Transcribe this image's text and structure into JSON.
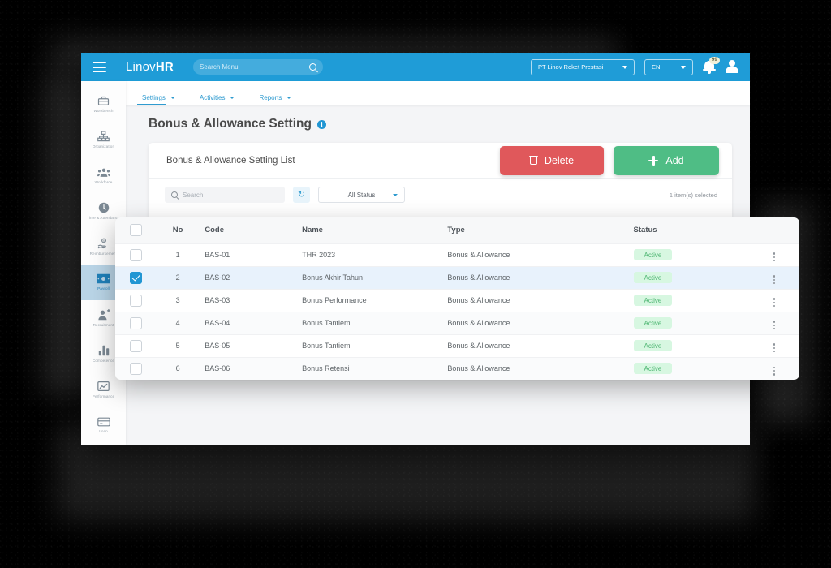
{
  "header": {
    "menu_icon": "hamburger-icon",
    "brand_light": "Linov",
    "brand_bold": "HR",
    "search_placeholder": "Search Menu",
    "search_value": "",
    "search_icon": "search-icon",
    "company": "PT Linov Roket Prestasi",
    "language": "EN",
    "notification_icon": "bell-icon",
    "notification_count": "99",
    "profile_icon": "user-avatar-icon",
    "bg_color": "#1f9cd7"
  },
  "sidebar": {
    "items": [
      {
        "label": "Workbench",
        "icon": "toolbox-icon",
        "glyph": "⚒",
        "active": false
      },
      {
        "label": "Organization",
        "icon": "org-chart-icon",
        "glyph": "☷",
        "active": false
      },
      {
        "label": "Workforce",
        "icon": "people-icon",
        "glyph": "὆5",
        "active": false
      },
      {
        "label": "Time & Attendance",
        "icon": "clock-icon",
        "glyph": "⏱",
        "active": false
      },
      {
        "label": "Reimbursement",
        "icon": "hand-money-icon",
        "glyph": "Ὃ0",
        "active": false
      },
      {
        "label": "Payroll",
        "icon": "banknote-icon",
        "glyph": "Ὃ5",
        "active": true
      },
      {
        "label": "Recruitment",
        "icon": "user-plus-icon",
        "glyph": "὆4",
        "active": false
      },
      {
        "label": "Competence",
        "icon": "bar-chart-icon",
        "glyph": "ὌA",
        "active": false
      },
      {
        "label": "Performance",
        "icon": "line-chart-icon",
        "glyph": "Ὄ8",
        "active": false
      },
      {
        "label": "Loan",
        "icon": "credit-card-icon",
        "glyph": "Ὃ3",
        "active": false
      }
    ]
  },
  "tabs": [
    {
      "label": "Settings",
      "active": true
    },
    {
      "label": "Activities",
      "active": false
    },
    {
      "label": "Reports",
      "active": false
    }
  ],
  "page": {
    "title": "Bonus & Allowance Setting",
    "info_icon": "info-icon",
    "info_glyph": "i"
  },
  "card": {
    "title": "Bonus & Allowance Setting List",
    "delete_label": "Delete",
    "delete_icon": "trash-icon",
    "delete_color": "#e0585b",
    "add_label": "Add",
    "add_icon": "plus-icon",
    "add_color": "#4fbd85",
    "search_placeholder": "Search",
    "search_value": "",
    "search_icon": "search-icon",
    "refresh_icon": "refresh-icon",
    "refresh_glyph": "↻",
    "status_filter": "All Status",
    "selected_text": "1 item(s) selected"
  },
  "table": {
    "columns": [
      "No",
      "Code",
      "Name",
      "Type",
      "Status"
    ],
    "header_checkbox_checked": false,
    "rows": [
      {
        "checked": false,
        "no": "1",
        "code": "BAS-01",
        "name": "THR 2023",
        "type": "Bonus & Allowance",
        "status": "Active"
      },
      {
        "checked": true,
        "no": "2",
        "code": "BAS-02",
        "name": "Bonus Akhir Tahun",
        "type": "Bonus & Allowance",
        "status": "Active"
      },
      {
        "checked": false,
        "no": "3",
        "code": "BAS-03",
        "name": "Bonus Performance",
        "type": "Bonus & Allowance",
        "status": "Active"
      },
      {
        "checked": false,
        "no": "4",
        "code": "BAS-04",
        "name": "Bonus Tantiem",
        "type": "Bonus & Allowance",
        "status": "Active"
      },
      {
        "checked": false,
        "no": "5",
        "code": "BAS-05",
        "name": "Bonus Tantiem",
        "type": "Bonus & Allowance",
        "status": "Active"
      },
      {
        "checked": false,
        "no": "6",
        "code": "BAS-06",
        "name": "Bonus Retensi",
        "type": "Bonus & Allowance",
        "status": "Active"
      }
    ],
    "row_menu_icon": "kebab-menu-icon",
    "status_badge_bg": "#d7f7e1",
    "status_badge_fg": "#49b36e"
  }
}
